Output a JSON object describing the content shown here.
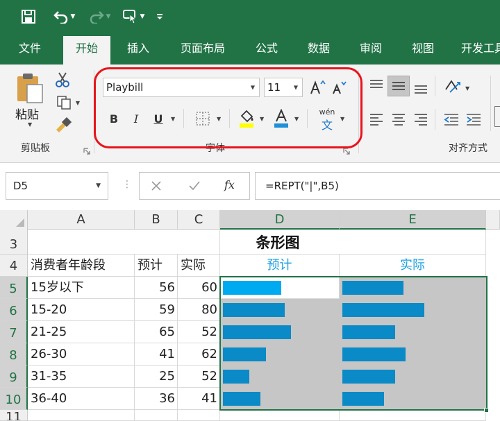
{
  "ribbon_tabs": [
    "文件",
    "开始",
    "插入",
    "页面布局",
    "公式",
    "数据",
    "审阅",
    "视图",
    "开发工具"
  ],
  "active_tab": "开始",
  "clipboard": {
    "paste_label": "粘贴",
    "group_label": "剪贴板"
  },
  "font": {
    "font_name": "Playbill",
    "font_size": "11",
    "group_label": "字体",
    "bold": "B",
    "italic": "I",
    "underline": "U",
    "phonetic": "wén",
    "phonetic_char": "文"
  },
  "alignment": {
    "group_label": "对齐方式"
  },
  "formula_bar": {
    "name_box": "D5",
    "fx": "fx",
    "formula": "=REPT(\"|\",B5)"
  },
  "sheet": {
    "columns": [
      "A",
      "B",
      "C",
      "D",
      "E"
    ],
    "selected_columns": [
      "D",
      "E"
    ],
    "row_numbers": [
      "3",
      "4",
      "5",
      "6",
      "7",
      "8",
      "9",
      "10",
      "11"
    ],
    "title": "条形图",
    "headers": {
      "a": "消费者年龄段",
      "b": "预计",
      "c": "实际",
      "d": "预计",
      "e": "实际"
    },
    "rows": [
      {
        "age": "15岁以下",
        "forecast": 56,
        "actual": 60
      },
      {
        "age": "15-20",
        "forecast": 59,
        "actual": 80
      },
      {
        "age": "21-25",
        "forecast": 65,
        "actual": 52
      },
      {
        "age": "26-30",
        "forecast": 41,
        "actual": 62
      },
      {
        "age": "31-35",
        "forecast": 25,
        "actual": 52
      },
      {
        "age": "36-40",
        "forecast": 36,
        "actual": 41
      }
    ]
  },
  "colors": {
    "excel_green": "#217346",
    "bar_blue": "#0a8ac6",
    "bar_blue_active": "#00aaf0",
    "header_blue": "#1ea0e0",
    "annotation_red": "#e8141c"
  }
}
